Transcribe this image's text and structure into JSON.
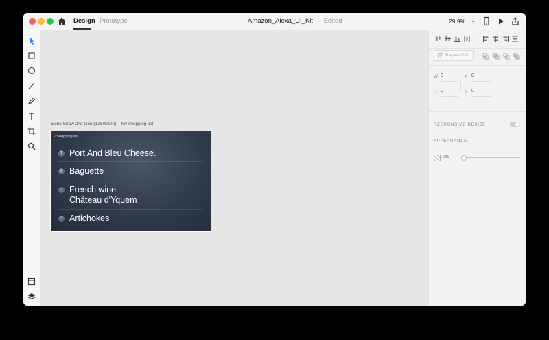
{
  "window": {
    "tabs": [
      {
        "label": "Design",
        "active": true
      },
      {
        "label": "Prototype",
        "active": false
      }
    ],
    "doc_title": "Amazon_Alexa_UI_Kit",
    "separator": "—",
    "status": "Edited",
    "zoom": "29.9%"
  },
  "toolbar": {
    "tools": [
      "select-icon",
      "rectangle-icon",
      "ellipse-icon",
      "line-icon",
      "pen-icon",
      "text-icon",
      "artboard-icon",
      "zoom-icon"
    ],
    "bottom_tools": [
      "assets-icon",
      "layers-icon"
    ]
  },
  "canvas": {
    "artboard_label": "Echo Show 2nd Gen (1280x800)  – My shopping list",
    "screen": {
      "back_label": "Shopping list",
      "items": [
        {
          "num": "1",
          "lines": [
            "Port And Bleu Cheese."
          ]
        },
        {
          "num": "2",
          "lines": [
            "Baguette"
          ]
        },
        {
          "num": "3",
          "lines": [
            "French wine",
            "Château d'Yquem"
          ]
        },
        {
          "num": "4",
          "lines": [
            "Artichokes"
          ]
        }
      ]
    }
  },
  "panel": {
    "repeat_grid": "Repeat Grid",
    "w_label": "W",
    "w_value": "0",
    "h_label": "H",
    "h_value": "0",
    "x_label": "X",
    "x_value": "0",
    "y_label": "Y",
    "y_value": "0",
    "responsive_resize": "RESPONSIVE RESIZE",
    "appearance": "APPEARANCE",
    "opacity": "0%"
  },
  "colors": {
    "close": "#fc5f57",
    "minimize": "#fdbc2e",
    "maximize": "#28c940",
    "select_tool": "#2d8ceb",
    "artboard_bg": "#2f3a4b"
  }
}
